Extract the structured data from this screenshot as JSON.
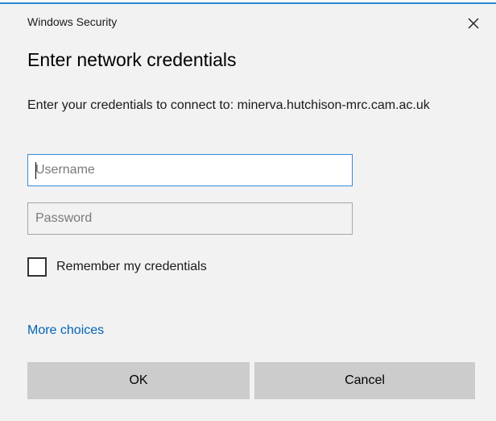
{
  "window": {
    "app_title": "Windows Security",
    "close_icon": "close-icon"
  },
  "dialog": {
    "heading": "Enter network credentials",
    "message": "Enter your credentials to connect to: minerva.hutchison-mrc.cam.ac.uk",
    "username_placeholder": "Username",
    "username_value": "",
    "password_placeholder": "Password",
    "password_value": "",
    "remember_label": "Remember my credentials",
    "remember_checked": false,
    "more_choices": "More choices",
    "ok_label": "OK",
    "cancel_label": "Cancel"
  },
  "colors": {
    "background": "#f2f2f2",
    "link": "#0064b8",
    "focus_border": "#3b8ad7",
    "button": "#cccccc"
  }
}
